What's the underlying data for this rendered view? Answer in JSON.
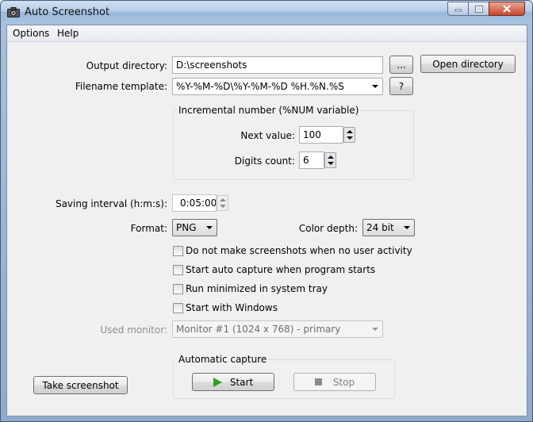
{
  "window": {
    "title": "Auto Screenshot"
  },
  "menu": {
    "options": "Options",
    "help": "Help"
  },
  "output": {
    "label": "Output directory:",
    "value": "D:\\screenshots",
    "browse_label": "...",
    "open_label": "Open directory"
  },
  "template": {
    "label": "Filename template:",
    "value": "%Y-%M-%D\\%Y-%M-%D %H.%N.%S",
    "help_label": "?"
  },
  "incremental": {
    "title": "Incremental number (%NUM variable)",
    "next_label": "Next value:",
    "next_value": "100",
    "digits_label": "Digits count:",
    "digits_value": "6"
  },
  "interval": {
    "label": "Saving interval (h:m:s):",
    "value": "0:05:00"
  },
  "format": {
    "label": "Format:",
    "value": "PNG"
  },
  "depth": {
    "label": "Color depth:",
    "value": "24 bit"
  },
  "checkboxes": [
    {
      "label": "Do not make screenshots when no user activity",
      "checked": false
    },
    {
      "label": "Start auto capture when program starts",
      "checked": false
    },
    {
      "label": "Run minimized in system tray",
      "checked": false
    },
    {
      "label": "Start with Windows",
      "checked": false
    }
  ],
  "monitor": {
    "label": "Used monitor:",
    "value": "Monitor #1 (1024 x 768) - primary"
  },
  "capture": {
    "title": "Automatic capture",
    "start_label": "Start",
    "stop_label": "Stop"
  },
  "take_label": "Take screenshot",
  "colors": {
    "start_icon": "#2ea125",
    "stop_icon": "#8a8a8a",
    "close_button": "#c9462d"
  }
}
